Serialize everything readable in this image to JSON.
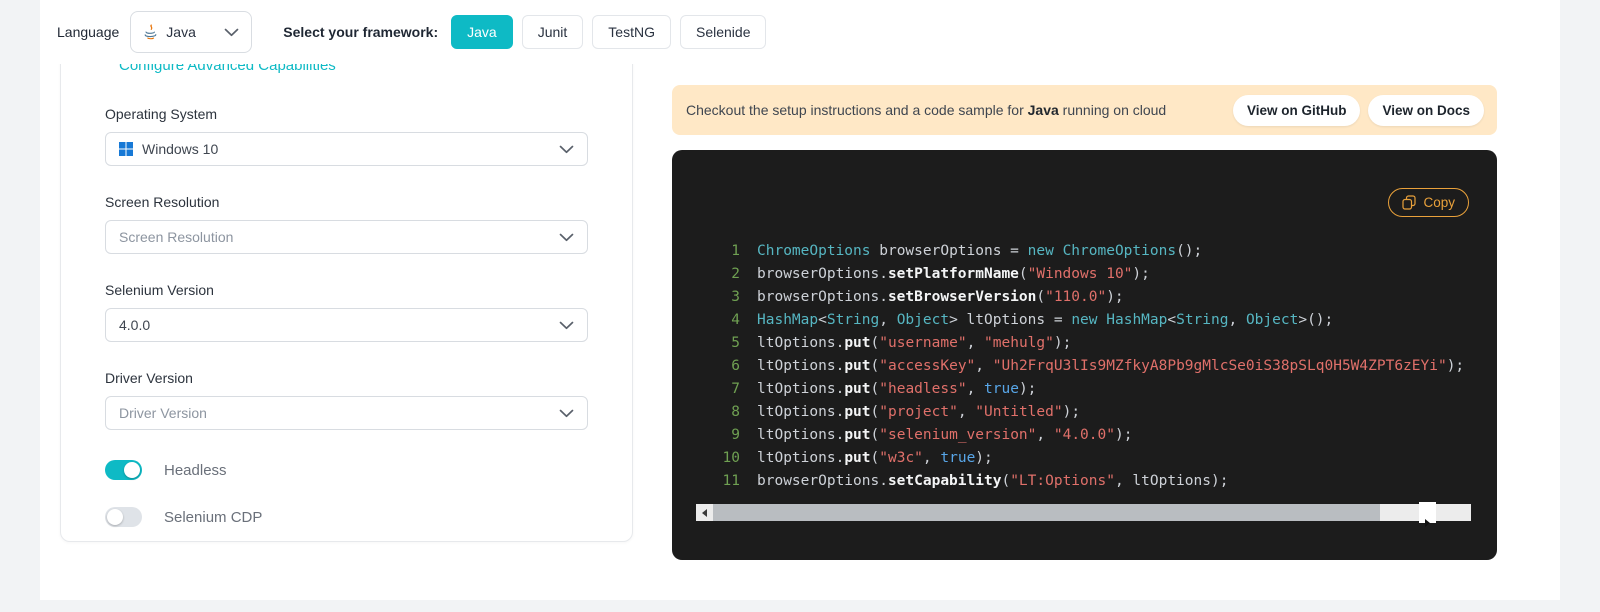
{
  "topbar": {
    "language_label": "Language",
    "language_value": "Java",
    "framework_label": "Select your framework:",
    "frameworks": [
      {
        "label": "Java",
        "active": true
      },
      {
        "label": "Junit",
        "active": false
      },
      {
        "label": "TestNG",
        "active": false
      },
      {
        "label": "Selenide",
        "active": false
      }
    ]
  },
  "panel": {
    "link": "Configure Advanced Capabilities",
    "os_label": "Operating System",
    "os_value": "Windows 10",
    "resolution_label": "Screen Resolution",
    "resolution_placeholder": "Screen Resolution",
    "selenium_label": "Selenium Version",
    "selenium_value": "4.0.0",
    "driver_label": "Driver Version",
    "driver_placeholder": "Driver Version",
    "headless_label": "Headless",
    "headless_on": true,
    "cdp_label": "Selenium CDP",
    "cdp_on": false
  },
  "banner": {
    "text_before": "Checkout the setup instructions and a code sample for ",
    "bold": "Java",
    "text_after": " running on cloud",
    "github_label": "View on GitHub",
    "docs_label": "View on Docs"
  },
  "code": {
    "copy_label": "Copy",
    "lines": [
      [
        {
          "t": "ChromeOptions",
          "c": "t"
        },
        {
          "t": " browserOptions = ",
          "c": "p"
        },
        {
          "t": "new",
          "c": "k"
        },
        {
          "t": " ",
          "c": "p"
        },
        {
          "t": "ChromeOptions",
          "c": "t"
        },
        {
          "t": "();",
          "c": "p"
        }
      ],
      [
        {
          "t": "browserOptions.",
          "c": "p"
        },
        {
          "t": "setPlatformName",
          "c": "m"
        },
        {
          "t": "(",
          "c": "p"
        },
        {
          "t": "\"Windows 10\"",
          "c": "s"
        },
        {
          "t": ");",
          "c": "p"
        }
      ],
      [
        {
          "t": "browserOptions.",
          "c": "p"
        },
        {
          "t": "setBrowserVersion",
          "c": "m"
        },
        {
          "t": "(",
          "c": "p"
        },
        {
          "t": "\"110.0\"",
          "c": "s"
        },
        {
          "t": ");",
          "c": "p"
        }
      ],
      [
        {
          "t": "HashMap",
          "c": "t"
        },
        {
          "t": "<",
          "c": "p"
        },
        {
          "t": "String",
          "c": "t"
        },
        {
          "t": ", ",
          "c": "p"
        },
        {
          "t": "Object",
          "c": "t"
        },
        {
          "t": "> ltOptions = ",
          "c": "p"
        },
        {
          "t": "new",
          "c": "k"
        },
        {
          "t": " ",
          "c": "p"
        },
        {
          "t": "HashMap",
          "c": "t"
        },
        {
          "t": "<",
          "c": "p"
        },
        {
          "t": "String",
          "c": "t"
        },
        {
          "t": ", ",
          "c": "p"
        },
        {
          "t": "Object",
          "c": "t"
        },
        {
          "t": ">();",
          "c": "p"
        }
      ],
      [
        {
          "t": "ltOptions.",
          "c": "p"
        },
        {
          "t": "put",
          "c": "m"
        },
        {
          "t": "(",
          "c": "p"
        },
        {
          "t": "\"username\"",
          "c": "s"
        },
        {
          "t": ", ",
          "c": "p"
        },
        {
          "t": "\"mehulg\"",
          "c": "s"
        },
        {
          "t": ");",
          "c": "p"
        }
      ],
      [
        {
          "t": "ltOptions.",
          "c": "p"
        },
        {
          "t": "put",
          "c": "m"
        },
        {
          "t": "(",
          "c": "p"
        },
        {
          "t": "\"accessKey\"",
          "c": "s"
        },
        {
          "t": ", ",
          "c": "p"
        },
        {
          "t": "\"Uh2FrqU3lIs9MZfkyA8Pb9gMlcSe0iS38pSLq0H5W4ZPT6zEYi\"",
          "c": "s"
        },
        {
          "t": ");",
          "c": "p"
        }
      ],
      [
        {
          "t": "ltOptions.",
          "c": "p"
        },
        {
          "t": "put",
          "c": "m"
        },
        {
          "t": "(",
          "c": "p"
        },
        {
          "t": "\"headless\"",
          "c": "s"
        },
        {
          "t": ", ",
          "c": "p"
        },
        {
          "t": "true",
          "c": "b"
        },
        {
          "t": ");",
          "c": "p"
        }
      ],
      [
        {
          "t": "ltOptions.",
          "c": "p"
        },
        {
          "t": "put",
          "c": "m"
        },
        {
          "t": "(",
          "c": "p"
        },
        {
          "t": "\"project\"",
          "c": "s"
        },
        {
          "t": ", ",
          "c": "p"
        },
        {
          "t": "\"Untitled\"",
          "c": "s"
        },
        {
          "t": ");",
          "c": "p"
        }
      ],
      [
        {
          "t": "ltOptions.",
          "c": "p"
        },
        {
          "t": "put",
          "c": "m"
        },
        {
          "t": "(",
          "c": "p"
        },
        {
          "t": "\"selenium_version\"",
          "c": "s"
        },
        {
          "t": ", ",
          "c": "p"
        },
        {
          "t": "\"4.0.0\"",
          "c": "s"
        },
        {
          "t": ");",
          "c": "p"
        }
      ],
      [
        {
          "t": "ltOptions.",
          "c": "p"
        },
        {
          "t": "put",
          "c": "m"
        },
        {
          "t": "(",
          "c": "p"
        },
        {
          "t": "\"w3c\"",
          "c": "s"
        },
        {
          "t": ", ",
          "c": "p"
        },
        {
          "t": "true",
          "c": "b"
        },
        {
          "t": ");",
          "c": "p"
        }
      ],
      [
        {
          "t": "browserOptions.",
          "c": "p"
        },
        {
          "t": "setCapability",
          "c": "m"
        },
        {
          "t": "(",
          "c": "p"
        },
        {
          "t": "\"LT:Options\"",
          "c": "s"
        },
        {
          "t": ", ltOptions);",
          "c": "p"
        }
      ]
    ]
  },
  "colors": {
    "accent": "#0ebac5",
    "banner_bg": "#ffe8c6",
    "copy_accent": "#e9a13b",
    "code_bg": "#1c1c1c",
    "line_number": "#6fa052",
    "string": "#e0706a",
    "type": "#56b6c2",
    "boolean": "#58a6e8"
  }
}
